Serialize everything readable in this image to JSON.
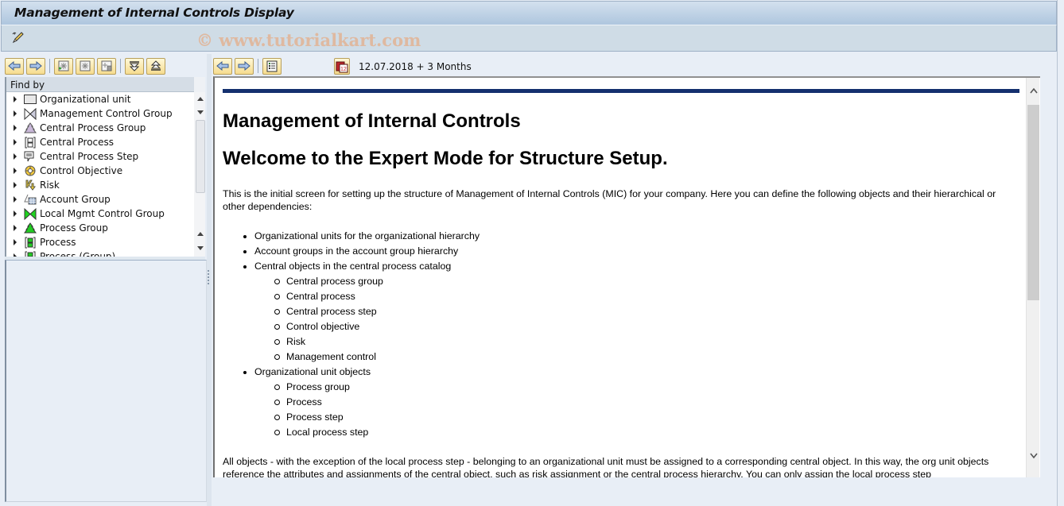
{
  "window": {
    "title": "Management of Internal Controls Display",
    "watermark": "© www.tutorialkart.com"
  },
  "app_toolbar": {
    "edit_icon": "display-change-icon"
  },
  "left_toolbar": {
    "buttons": [
      {
        "name": "back-button",
        "icon": "arrow-left-icon"
      },
      {
        "name": "forward-button",
        "icon": "arrow-right-icon"
      },
      {
        "name": "create-button",
        "icon": "create-object-icon"
      },
      {
        "name": "display-button",
        "icon": "object-icon"
      },
      {
        "name": "delete-button",
        "icon": "delete-object-icon"
      },
      {
        "name": "expand-all-button",
        "icon": "expand-icon"
      },
      {
        "name": "collapse-all-button",
        "icon": "collapse-icon"
      }
    ]
  },
  "tree": {
    "header": "Find by",
    "items": [
      {
        "label": "Organizational unit",
        "icon": "org-unit-icon"
      },
      {
        "label": "Management Control Group",
        "icon": "control-group-icon"
      },
      {
        "label": "Central Process Group",
        "icon": "central-process-group-icon"
      },
      {
        "label": "Central Process",
        "icon": "central-process-icon"
      },
      {
        "label": "Central Process Step",
        "icon": "central-process-step-icon"
      },
      {
        "label": "Control Objective",
        "icon": "control-objective-icon"
      },
      {
        "label": "Risk",
        "icon": "risk-icon"
      },
      {
        "label": "Account Group",
        "icon": "account-group-icon"
      },
      {
        "label": "Local Mgmt Control Group",
        "icon": "local-control-group-icon"
      },
      {
        "label": "Process Group",
        "icon": "process-group-icon"
      },
      {
        "label": "Process",
        "icon": "process-icon"
      },
      {
        "label": "Process (Group)",
        "icon": "process-icon"
      }
    ]
  },
  "right_toolbar": {
    "buttons": [
      {
        "name": "back-button",
        "icon": "arrow-left-icon"
      },
      {
        "name": "forward-button",
        "icon": "arrow-right-icon"
      },
      {
        "name": "document-button",
        "icon": "document-list-icon"
      }
    ],
    "calendar_icon": "calendar-icon",
    "date_text": "12.07.2018  + 3 Months"
  },
  "content": {
    "heading1": "Management of Internal Controls",
    "heading2": "Welcome to the Expert Mode for Structure Setup.",
    "intro": "This is the initial screen for setting up the structure of Management of Internal Controls (MIC) for your company. Here you can define the following objects and their hierarchical or other dependencies:",
    "list": [
      {
        "text": "Organizational units for the organizational hierarchy",
        "children": []
      },
      {
        "text": "Account groups in the account group hierarchy",
        "children": []
      },
      {
        "text": "Central objects in the central process catalog",
        "children": [
          "Central process group",
          "Central process",
          "Central process step",
          "Control objective",
          "Risk",
          "Management control"
        ]
      },
      {
        "text": "Organizational unit objects",
        "children": [
          "Process group",
          "Process",
          "Process step",
          "Local process step"
        ]
      }
    ],
    "footer_para": "All objects - with the exception of the local process step - belonging to an organizational unit must be assigned to a corresponding central object. In this way, the org unit objects reference the attributes and assignments of the central object, such as risk assignment or the central process hierarchy. You can only assign the local process step"
  },
  "colors": {
    "title_gradient_top": "#d3e0ee",
    "title_gradient_bottom": "#aec6de",
    "background": "#e8eef6",
    "rule": "#14306e",
    "button_fill": "#f6dc8e"
  }
}
